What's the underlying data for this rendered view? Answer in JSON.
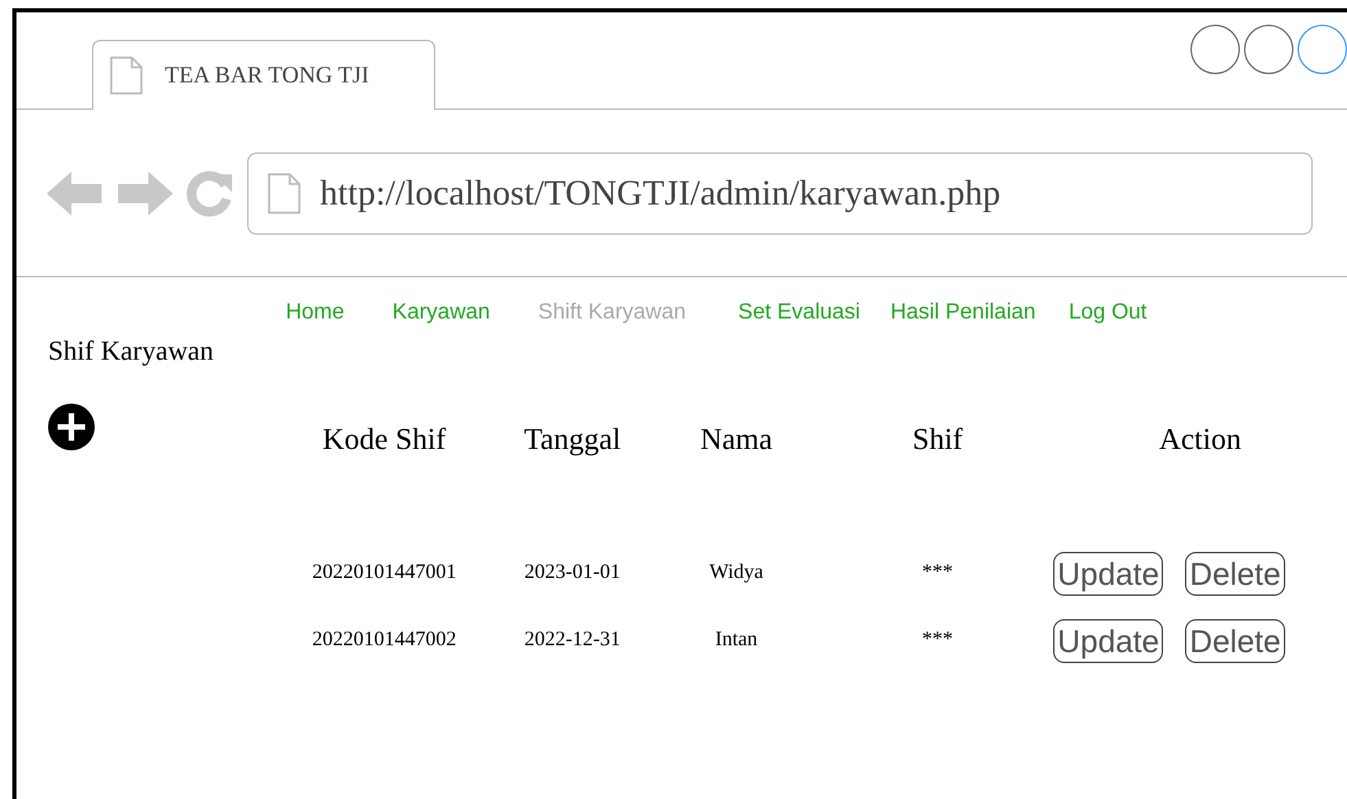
{
  "window": {
    "tab_title": "TEA BAR TONG TJI",
    "url": "http://localhost/TONGTJI/admin/karyawan.php"
  },
  "window_controls": [
    {
      "color": "#666666"
    },
    {
      "color": "#666666"
    },
    {
      "color": "#3399ff"
    }
  ],
  "nav": [
    {
      "label": "Home",
      "selected": false
    },
    {
      "label": "Karyawan",
      "selected": false
    },
    {
      "label": "Shift Karyawan",
      "selected": true
    },
    {
      "label": "Set Evaluasi",
      "selected": false
    },
    {
      "label": "Hasil Penilaian",
      "selected": false
    },
    {
      "label": "Log Out",
      "selected": false
    }
  ],
  "page_title": "Shif Karyawan",
  "table": {
    "columns": [
      "Kode Shif",
      "Tanggal",
      "Nama",
      "Shif",
      "Action"
    ],
    "rows": [
      {
        "cells": [
          "20220101447001",
          "2023-01-01",
          "Widya",
          "***"
        ],
        "actions": [
          "Update",
          "Delete"
        ]
      },
      {
        "cells": [
          "20220101447002",
          "2022-12-31",
          "Intan",
          "***"
        ],
        "actions": [
          "Update",
          "Delete"
        ]
      }
    ]
  }
}
